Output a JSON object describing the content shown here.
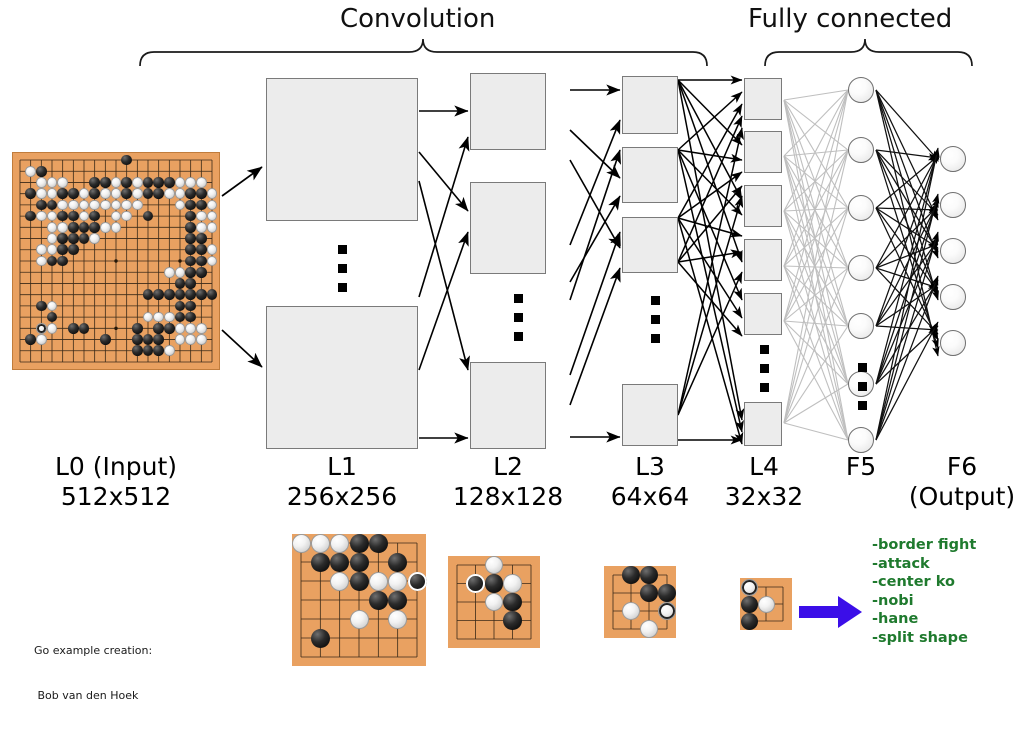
{
  "figure": {
    "title": "Go convolutional neural network architecture diagram",
    "background": "#ffffff"
  },
  "groups": {
    "convolution_label": "Convolution",
    "fully_connected_label": "Fully connected"
  },
  "layers": [
    {
      "id": "L0",
      "name": "L0 (Input)",
      "size": "512x512",
      "kind": "goboard",
      "boxes": 0
    },
    {
      "id": "L1",
      "name": "L1",
      "size": "256x256",
      "kind": "boxes",
      "boxes": 2
    },
    {
      "id": "L2",
      "name": "L2",
      "size": "128x128",
      "kind": "boxes",
      "boxes": 3
    },
    {
      "id": "L3",
      "name": "L3",
      "size": "64x64",
      "kind": "boxes",
      "boxes": 4
    },
    {
      "id": "L4",
      "name": "L4",
      "size": "32x32",
      "kind": "boxes",
      "boxes": 6
    },
    {
      "id": "F5",
      "name": "F5",
      "size": "",
      "kind": "neurons",
      "boxes": 7
    },
    {
      "id": "F6",
      "name": "F6 (Output)",
      "size": "",
      "kind": "neurons",
      "boxes": 5
    }
  ],
  "captions": {
    "l0_line1": "L0 (Input)",
    "l0_line2": "512x512",
    "l1_line1": "L1",
    "l1_line2": "256x256",
    "l2_line1": "L2",
    "l2_line2": "128x128",
    "l3_line1": "L3",
    "l3_line2": "64x64",
    "l4_line1": "L4",
    "l4_line2": "32x32",
    "f5_line1": "F5",
    "f6_line1": "F6",
    "f6_line2": "(Output)"
  },
  "outputs": {
    "items": [
      "-border fight",
      "-attack",
      "-center ko",
      "-nobi",
      "-hane",
      "-split shape"
    ],
    "color": "#1f7a2e"
  },
  "credit": {
    "line1": "Go example creation:",
    "line2": " Bob van den Hoek"
  },
  "colors": {
    "board": "#e9a161",
    "board_line": "#3a2a18",
    "box_fill": "#ececec",
    "box_border": "#7a7a7a",
    "arrow": "#000000",
    "fc_edge": "#b8b8b8",
    "output_arrow": "#3b0ee8",
    "output_text": "#1f7a2e"
  },
  "boards": {
    "input": {
      "id": "board-input",
      "grid": 19,
      "black": [
        [
          10,
          18
        ],
        [
          2,
          17
        ],
        [
          7,
          16
        ],
        [
          8,
          16
        ],
        [
          10,
          16
        ],
        [
          12,
          16
        ],
        [
          13,
          16
        ],
        [
          14,
          16
        ],
        [
          1,
          15
        ],
        [
          4,
          15
        ],
        [
          5,
          15
        ],
        [
          7,
          15
        ],
        [
          10,
          15
        ],
        [
          12,
          15
        ],
        [
          13,
          15
        ],
        [
          16,
          15
        ],
        [
          17,
          15
        ],
        [
          2,
          14
        ],
        [
          3,
          14
        ],
        [
          16,
          14
        ],
        [
          17,
          14
        ],
        [
          1,
          13
        ],
        [
          4,
          13
        ],
        [
          5,
          13
        ],
        [
          7,
          13
        ],
        [
          12,
          13
        ],
        [
          16,
          13
        ],
        [
          5,
          12
        ],
        [
          6,
          12
        ],
        [
          7,
          12
        ],
        [
          16,
          12
        ],
        [
          4,
          11
        ],
        [
          5,
          11
        ],
        [
          6,
          11
        ],
        [
          16,
          11
        ],
        [
          17,
          11
        ],
        [
          4,
          10
        ],
        [
          5,
          10
        ],
        [
          16,
          10
        ],
        [
          17,
          10
        ],
        [
          3,
          9
        ],
        [
          4,
          9
        ],
        [
          16,
          9
        ],
        [
          17,
          9
        ],
        [
          16,
          8
        ],
        [
          17,
          8
        ],
        [
          15,
          7
        ],
        [
          16,
          7
        ],
        [
          12,
          6
        ],
        [
          13,
          6
        ],
        [
          14,
          6
        ],
        [
          15,
          6
        ],
        [
          16,
          6
        ],
        [
          17,
          6
        ],
        [
          18,
          6
        ],
        [
          2,
          5
        ],
        [
          15,
          5
        ],
        [
          16,
          5
        ],
        [
          3,
          4
        ],
        [
          15,
          4
        ],
        [
          16,
          4
        ],
        [
          5,
          3
        ],
        [
          6,
          3
        ],
        [
          11,
          3
        ],
        [
          13,
          3
        ],
        [
          14,
          3
        ],
        [
          1,
          2
        ],
        [
          8,
          2
        ],
        [
          11,
          2
        ],
        [
          12,
          2
        ],
        [
          13,
          2
        ],
        [
          11,
          1
        ],
        [
          12,
          1
        ],
        [
          13,
          1
        ]
      ],
      "white": [
        [
          1,
          17
        ],
        [
          2,
          16
        ],
        [
          3,
          16
        ],
        [
          4,
          16
        ],
        [
          9,
          16
        ],
        [
          11,
          16
        ],
        [
          15,
          16
        ],
        [
          16,
          16
        ],
        [
          17,
          16
        ],
        [
          2,
          15
        ],
        [
          3,
          15
        ],
        [
          6,
          15
        ],
        [
          8,
          15
        ],
        [
          9,
          15
        ],
        [
          11,
          15
        ],
        [
          14,
          15
        ],
        [
          15,
          15
        ],
        [
          18,
          15
        ],
        [
          4,
          14
        ],
        [
          5,
          14
        ],
        [
          6,
          14
        ],
        [
          7,
          14
        ],
        [
          8,
          14
        ],
        [
          9,
          14
        ],
        [
          10,
          14
        ],
        [
          11,
          14
        ],
        [
          15,
          14
        ],
        [
          18,
          14
        ],
        [
          2,
          13
        ],
        [
          3,
          13
        ],
        [
          6,
          13
        ],
        [
          9,
          13
        ],
        [
          10,
          13
        ],
        [
          17,
          13
        ],
        [
          18,
          13
        ],
        [
          3,
          12
        ],
        [
          8,
          12
        ],
        [
          9,
          12
        ],
        [
          4,
          12
        ],
        [
          17,
          12
        ],
        [
          18,
          12
        ],
        [
          3,
          11
        ],
        [
          7,
          11
        ],
        [
          17,
          11
        ],
        [
          2,
          10
        ],
        [
          3,
          10
        ],
        [
          18,
          10
        ],
        [
          2,
          9
        ],
        [
          17,
          9
        ],
        [
          18,
          9
        ],
        [
          14,
          8
        ],
        [
          15,
          8
        ],
        [
          16,
          8
        ],
        [
          3,
          5
        ],
        [
          12,
          4
        ],
        [
          13,
          4
        ],
        [
          14,
          4
        ],
        [
          2,
          3
        ],
        [
          3,
          3
        ],
        [
          15,
          3
        ],
        [
          16,
          3
        ],
        [
          17,
          3
        ],
        [
          2,
          2
        ],
        [
          15,
          2
        ],
        [
          16,
          2
        ],
        [
          17,
          2
        ],
        [
          14,
          1
        ]
      ],
      "marked": [
        [
          2,
          3
        ]
      ]
    },
    "crop_l1": {
      "id": "board-crop-1",
      "grid": 7,
      "black": [
        [
          3,
          6
        ],
        [
          4,
          6
        ],
        [
          1,
          5
        ],
        [
          2,
          5
        ],
        [
          3,
          5
        ],
        [
          5,
          5
        ],
        [
          3,
          4
        ],
        [
          6,
          4
        ],
        [
          4,
          3
        ],
        [
          5,
          3
        ],
        [
          1,
          1
        ]
      ],
      "white": [
        [
          0,
          6
        ],
        [
          1,
          6
        ],
        [
          2,
          6
        ],
        [
          2,
          4
        ],
        [
          4,
          4
        ],
        [
          5,
          4
        ],
        [
          3,
          2
        ],
        [
          5,
          2
        ]
      ],
      "marked": [
        [
          6,
          4
        ]
      ]
    },
    "crop_l2": {
      "id": "board-crop-2",
      "grid": 5,
      "black": [
        [
          1,
          3
        ],
        [
          2,
          3
        ],
        [
          3,
          2
        ],
        [
          3,
          1
        ]
      ],
      "white": [
        [
          2,
          4
        ],
        [
          3,
          3
        ],
        [
          2,
          2
        ]
      ],
      "marked": [
        [
          1,
          3
        ]
      ]
    },
    "crop_l3": {
      "id": "board-crop-3",
      "grid": 4,
      "black": [
        [
          1,
          3
        ],
        [
          2,
          3
        ],
        [
          2,
          2
        ],
        [
          3,
          2
        ]
      ],
      "white": [
        [
          3,
          2
        ],
        [
          1,
          1
        ],
        [
          2,
          0
        ],
        [
          3,
          1
        ]
      ],
      "marked": [
        [
          3,
          1
        ]
      ]
    },
    "crop_l4": {
      "id": "board-crop-4",
      "grid": 3,
      "black": [
        [
          0,
          1
        ],
        [
          0,
          0
        ]
      ],
      "white": [
        [
          0,
          2
        ],
        [
          1,
          1
        ]
      ],
      "marked": [
        [
          0,
          2
        ]
      ]
    }
  }
}
